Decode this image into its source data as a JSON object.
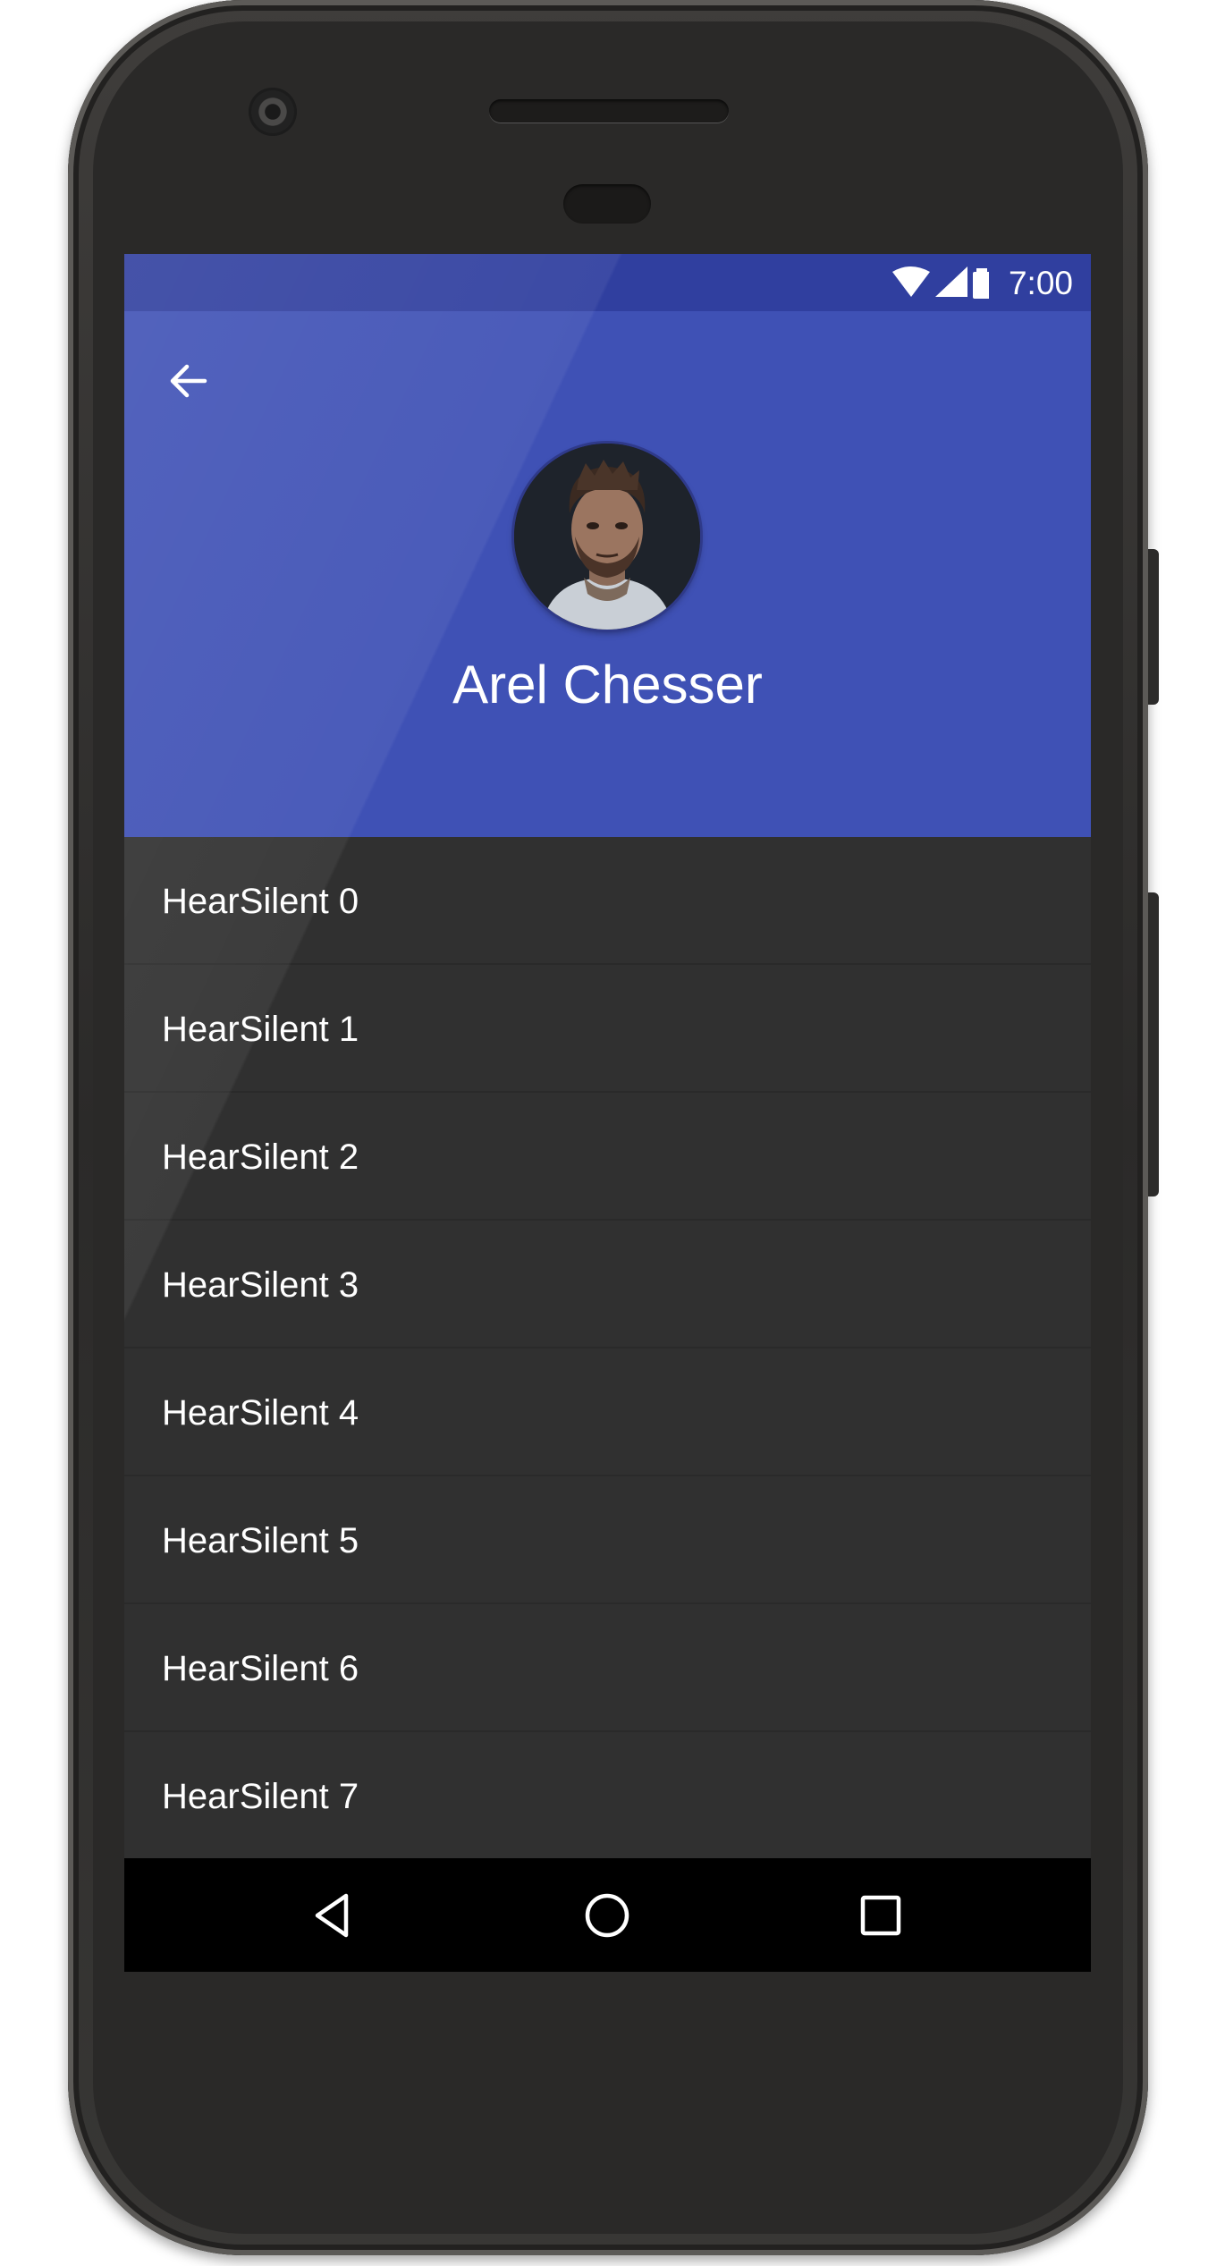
{
  "status_bar": {
    "time": "7:00",
    "icons": [
      "wifi-icon",
      "signal-icon",
      "battery-icon"
    ]
  },
  "header": {
    "back_icon": "arrow-left-icon",
    "profile_name": "Arel Chesser",
    "avatar_icon": "profile-photo"
  },
  "list": {
    "items": [
      "HearSilent 0",
      "HearSilent 1",
      "HearSilent 2",
      "HearSilent 3",
      "HearSilent 4",
      "HearSilent 5",
      "HearSilent 6",
      "HearSilent 7"
    ]
  },
  "nav_bar": {
    "icons": [
      "nav-back-icon",
      "nav-home-icon",
      "nav-recents-icon"
    ]
  },
  "colors": {
    "primary": "#3f51b5",
    "primary_dark": "#303f9f",
    "list_background": "#303030",
    "text": "#ffffff"
  }
}
